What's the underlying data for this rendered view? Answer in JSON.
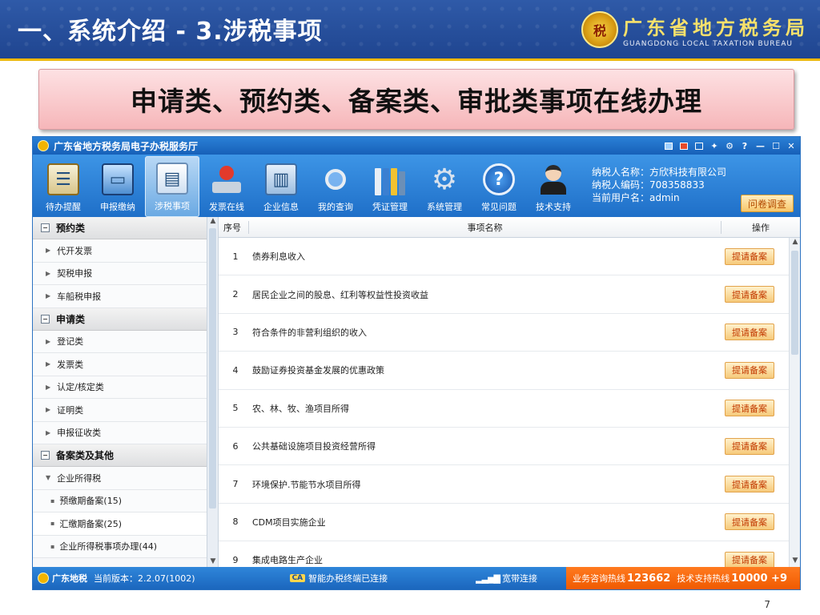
{
  "slide": {
    "title": "一、系统介绍 - 3.涉税事项",
    "bureau_cn": "广东省地方税务局",
    "bureau_en": "GUANGDONG LOCAL TAXATION BUREAU",
    "banner": "申请类、预约类、备案类、审批类事项在线办理",
    "page_number": "7"
  },
  "app": {
    "window_title": "广东省地方税务局电子办税服务厅",
    "toolbar": [
      {
        "label": "待办提醒",
        "icon": "clipboard-icon"
      },
      {
        "label": "申报缴纳",
        "icon": "computer-icon"
      },
      {
        "label": "涉税事项",
        "icon": "form-icon",
        "active": true
      },
      {
        "label": "发票在线",
        "icon": "stamp-icon"
      },
      {
        "label": "企业信息",
        "icon": "building-icon"
      },
      {
        "label": "我的查询",
        "icon": "search-icon"
      },
      {
        "label": "凭证管理",
        "icon": "folder-icon"
      },
      {
        "label": "系统管理",
        "icon": "gear-icon"
      },
      {
        "label": "常见问题",
        "icon": "help-icon"
      },
      {
        "label": "技术支持",
        "icon": "support-person-icon"
      }
    ],
    "taxpayer": {
      "name": "纳税人名称：方欣科技有限公司",
      "code": "纳税人编码：708358833",
      "user": "当前用户名：admin"
    },
    "survey_label": "问卷调查",
    "sidebar": {
      "groups": [
        {
          "label": "预约类",
          "items": [
            "代开发票",
            "契税申报",
            "车船税申报"
          ]
        },
        {
          "label": "申请类",
          "items": [
            "登记类",
            "发票类",
            "认定/核定类",
            "证明类",
            "申报征收类"
          ]
        },
        {
          "label": "备案类及其他",
          "items": [
            "企业所得税"
          ]
        }
      ],
      "subitems": [
        "预缴期备案(15)",
        "汇缴期备案(25)",
        "企业所得税事项办理(44)"
      ]
    },
    "table": {
      "headers": {
        "no": "序号",
        "name": "事项名称",
        "op": "操作"
      },
      "action_label": "提请备案",
      "rows": [
        {
          "no": "1",
          "name": "债券利息收入"
        },
        {
          "no": "2",
          "name": "居民企业之间的股息、红利等权益性投资收益"
        },
        {
          "no": "3",
          "name": "符合条件的非营利组织的收入"
        },
        {
          "no": "4",
          "name": "鼓励证券投资基金发展的优惠政策"
        },
        {
          "no": "5",
          "name": "农、林、牧、渔项目所得"
        },
        {
          "no": "6",
          "name": "公共基础设施项目投资经营所得"
        },
        {
          "no": "7",
          "name": "环境保护.节能节水项目所得"
        },
        {
          "no": "8",
          "name": "CDM项目实施企业"
        },
        {
          "no": "9",
          "name": "集成电路生产企业"
        }
      ]
    },
    "status": {
      "brand": "广东地税",
      "version": "当前版本：2.2.07(1002)",
      "ca": "CA",
      "connection": "智能办税终端已连接",
      "broadband": "宽带连接",
      "hotline_label": "业务咨询热线",
      "hotline_number": "123662",
      "tech_label": "技术支持热线",
      "tech_number": "10000 +9"
    },
    "colors": {
      "header_blue": "#1f6fc8",
      "action_orange": "#c23a00",
      "hotline_orange": "#f05a00"
    }
  }
}
